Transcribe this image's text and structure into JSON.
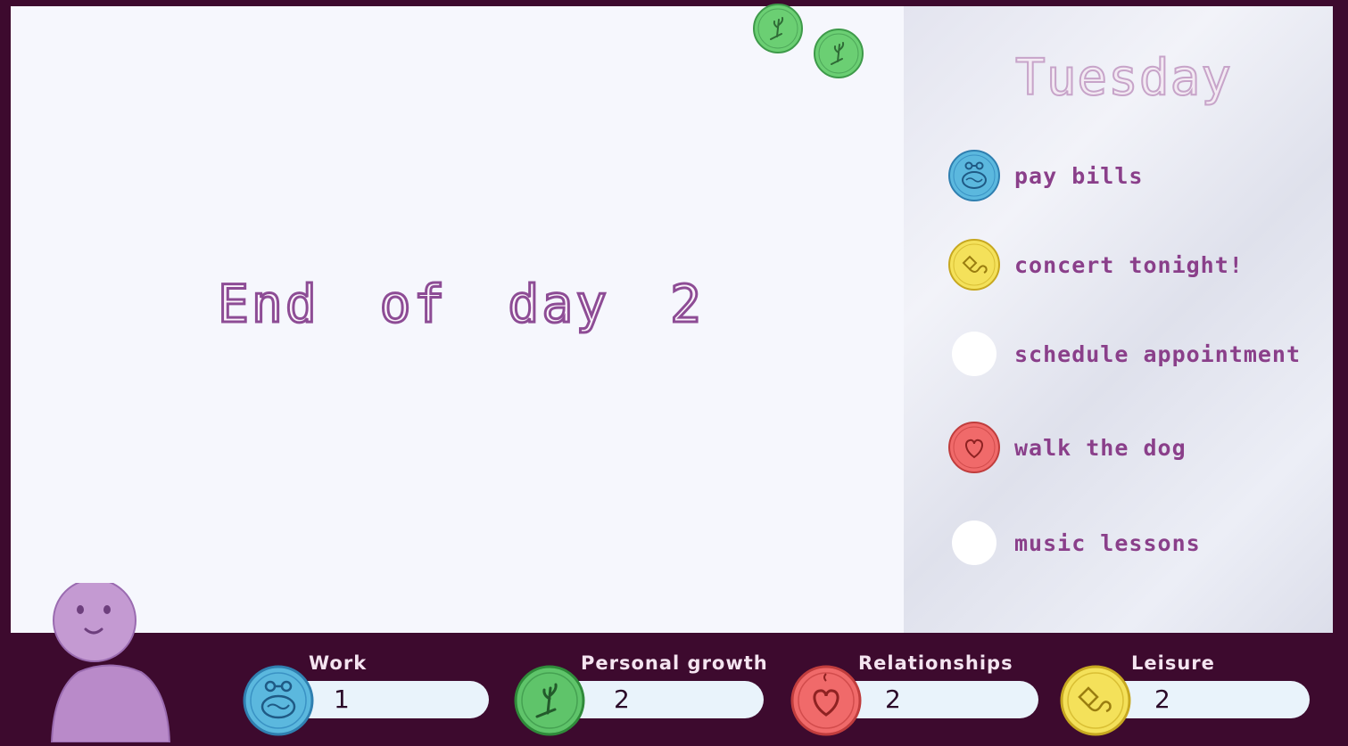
{
  "main": {
    "title": "End of day 2"
  },
  "day_panel": {
    "title": "Tuesday",
    "tasks": [
      {
        "label": "pay bills",
        "icon": "work-brain-icon",
        "color": "#5bb8de"
      },
      {
        "label": "concert tonight!",
        "icon": "leisure-kite-icon",
        "color": "#f4e15a"
      },
      {
        "label": "schedule appointment",
        "icon": "empty-slot-icon",
        "color": "#ffffff"
      },
      {
        "label": "walk the dog",
        "icon": "relationships-heart-icon",
        "color": "#f06a6a"
      },
      {
        "label": "music lessons",
        "icon": "empty-slot-icon",
        "color": "#ffffff"
      }
    ]
  },
  "stats": [
    {
      "name": "Work",
      "value": "1",
      "icon": "work-brain-icon",
      "color": "#5bb8de"
    },
    {
      "name": "Personal growth",
      "value": "2",
      "icon": "growth-sprout-icon",
      "color": "#5fc46a"
    },
    {
      "name": "Relationships",
      "value": "2",
      "icon": "relationships-heart-icon",
      "color": "#f06a6a"
    },
    {
      "name": "Leisure",
      "value": "2",
      "icon": "leisure-kite-icon",
      "color": "#f4e15a"
    }
  ],
  "colors": {
    "background": "#3d0a2e",
    "paper": "#f6f7fd",
    "text_purple": "#8a3f8a",
    "character": "#b98ac9"
  }
}
